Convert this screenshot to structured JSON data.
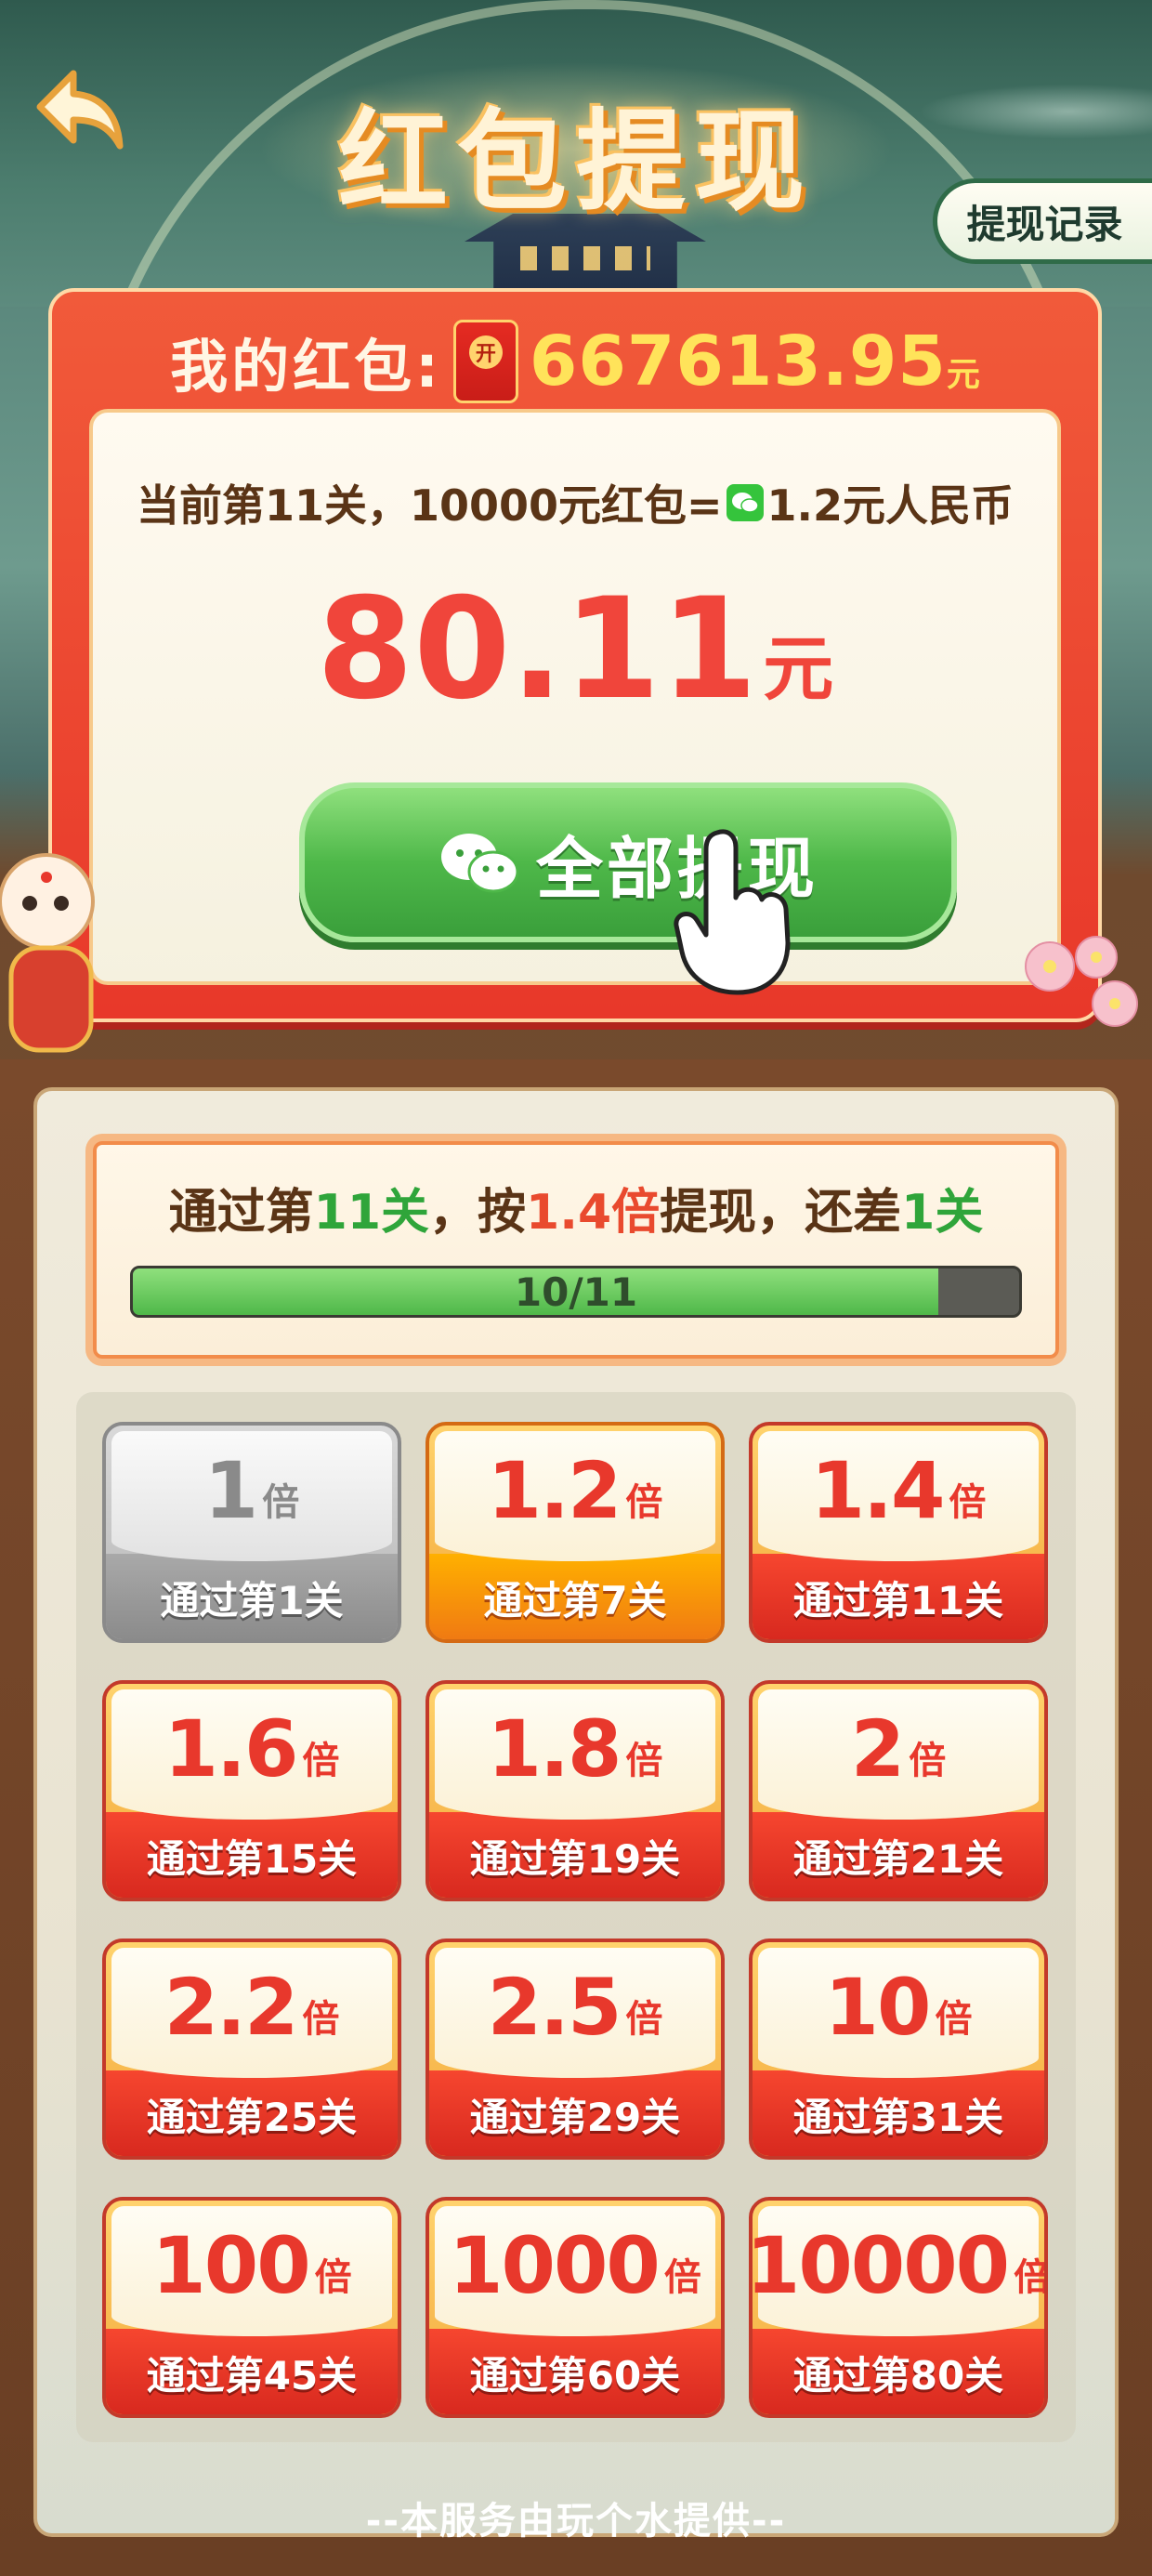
{
  "header": {
    "title": "红包提现",
    "history_label": "提现记录"
  },
  "wallet": {
    "label": "我的红包:",
    "amount": "667613.95",
    "unit": "元",
    "level_prefix": "当前第11关，10000元红包=",
    "level_suffix": "1.2元人民币",
    "withdraw_amount": "80.11",
    "withdraw_unit": "元",
    "withdraw_all_label": "全部提现"
  },
  "progress": {
    "text_parts": [
      "通过第",
      "11关",
      "，按",
      "1.4倍",
      "提现，还差",
      "1关"
    ],
    "label": "10/11",
    "current": 10,
    "total": 11
  },
  "tiers": [
    {
      "multiplier": "1",
      "unit": "倍",
      "condition": "通过第1关",
      "state": "done"
    },
    {
      "multiplier": "1.2",
      "unit": "倍",
      "condition": "通过第7关",
      "state": "current"
    },
    {
      "multiplier": "1.4",
      "unit": "倍",
      "condition": "通过第11关",
      "state": "locked"
    },
    {
      "multiplier": "1.6",
      "unit": "倍",
      "condition": "通过第15关",
      "state": "locked"
    },
    {
      "multiplier": "1.8",
      "unit": "倍",
      "condition": "通过第19关",
      "state": "locked"
    },
    {
      "multiplier": "2",
      "unit": "倍",
      "condition": "通过第21关",
      "state": "locked"
    },
    {
      "multiplier": "2.2",
      "unit": "倍",
      "condition": "通过第25关",
      "state": "locked"
    },
    {
      "multiplier": "2.5",
      "unit": "倍",
      "condition": "通过第29关",
      "state": "locked"
    },
    {
      "multiplier": "10",
      "unit": "倍",
      "condition": "通过第31关",
      "state": "locked"
    },
    {
      "multiplier": "100",
      "unit": "倍",
      "condition": "通过第45关",
      "state": "locked"
    },
    {
      "multiplier": "1000",
      "unit": "倍",
      "condition": "通过第60关",
      "state": "locked"
    },
    {
      "multiplier": "10000",
      "unit": "倍",
      "condition": "通过第80关",
      "state": "locked"
    }
  ],
  "footer": {
    "text": "--本服务由玩个水提供--"
  },
  "colors": {
    "accent_red": "#e8382c",
    "accent_green": "#4eb849",
    "gold": "#ffe35a"
  },
  "icons": [
    "back-arrow-icon",
    "red-packet-icon",
    "wechat-icon",
    "pointing-hand-icon"
  ]
}
